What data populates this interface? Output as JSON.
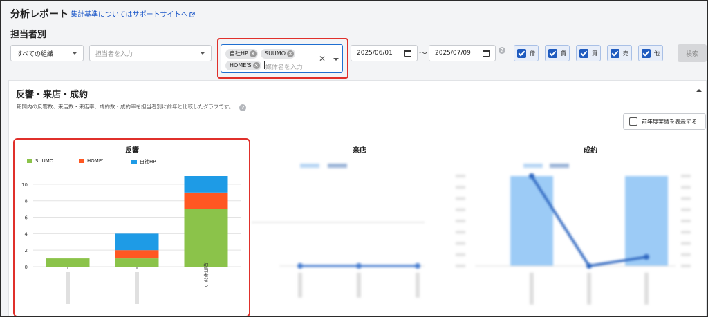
{
  "header": {
    "title": "分析レポート",
    "help_link": "集計基準についてはサポートサイトへ",
    "subtitle": "担当者別"
  },
  "filters": {
    "organization": "すべての組織",
    "person_placeholder": "担当者を入力",
    "media_chips": [
      "自社HP",
      "SUUMO",
      "HOME'S"
    ],
    "media_placeholder": "媒体名を入力",
    "date_from": "2025/06/01",
    "date_separator": "〜",
    "date_to": "2025/07/09",
    "types": [
      {
        "label": "借",
        "checked": true
      },
      {
        "label": "貸",
        "checked": true
      },
      {
        "label": "買",
        "checked": true
      },
      {
        "label": "売",
        "checked": true
      },
      {
        "label": "他",
        "checked": true
      }
    ],
    "search_label": "検索"
  },
  "section": {
    "title": "反響・来店・成約",
    "description": "期間内の反響数、来店数・来店率、成約数・成約率を担当者別に前年と比較したグラフです。",
    "prev_year_label": "前年度実績を表示する"
  },
  "colors": {
    "suumo": "#8bc34a",
    "homes": "#ff5722",
    "own_hp": "#1e9be6",
    "accent": "#1f5bbf",
    "highlight": "#e0302b"
  },
  "chart_data": [
    {
      "type": "bar",
      "stacked": true,
      "title": "反響",
      "categories": [
        "",
        "",
        "担当者なし"
      ],
      "series": [
        {
          "name": "SUUMO",
          "values": [
            1,
            1,
            7
          ]
        },
        {
          "name": "HOME'…",
          "values": [
            0,
            1,
            2
          ]
        },
        {
          "name": "自社HP",
          "values": [
            0,
            2,
            2
          ]
        }
      ],
      "yticks": [
        0,
        2,
        4,
        6,
        8,
        10
      ],
      "ylim": [
        0,
        11
      ],
      "grid": true,
      "legend": "top"
    },
    {
      "type": "line",
      "title": "来店",
      "blurred": true,
      "values": [
        0,
        0,
        0
      ]
    },
    {
      "type": "bar",
      "title": "成約",
      "blurred": true,
      "bars": [
        1,
        0,
        1
      ],
      "line": [
        1,
        0,
        0.1
      ]
    }
  ]
}
